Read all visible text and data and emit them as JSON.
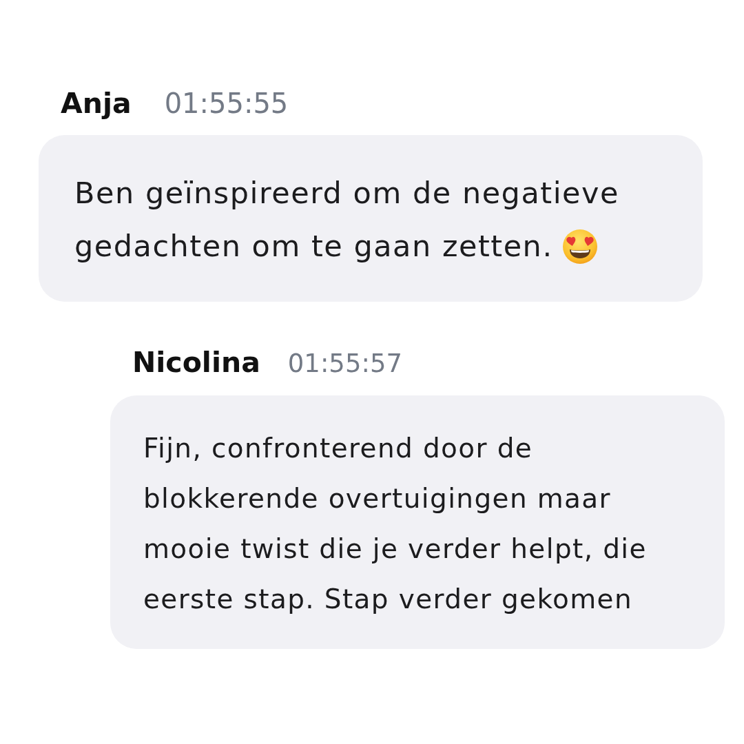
{
  "messages": [
    {
      "author": "Anja",
      "time": "01:55:55",
      "reply": false,
      "lines": [
        "Ben geïnspireerd om de negatieve",
        "gedachten om te gaan zetten."
      ],
      "emoji": true
    },
    {
      "author": "Nicolina",
      "time": "01:55:57",
      "reply": true,
      "lines": [
        "Fijn, confronterend door de",
        "blokkerende overtuigingen maar",
        "mooie twist die je verder helpt, die",
        "eerste stap. Stap verder gekomen"
      ],
      "emoji": false
    }
  ]
}
